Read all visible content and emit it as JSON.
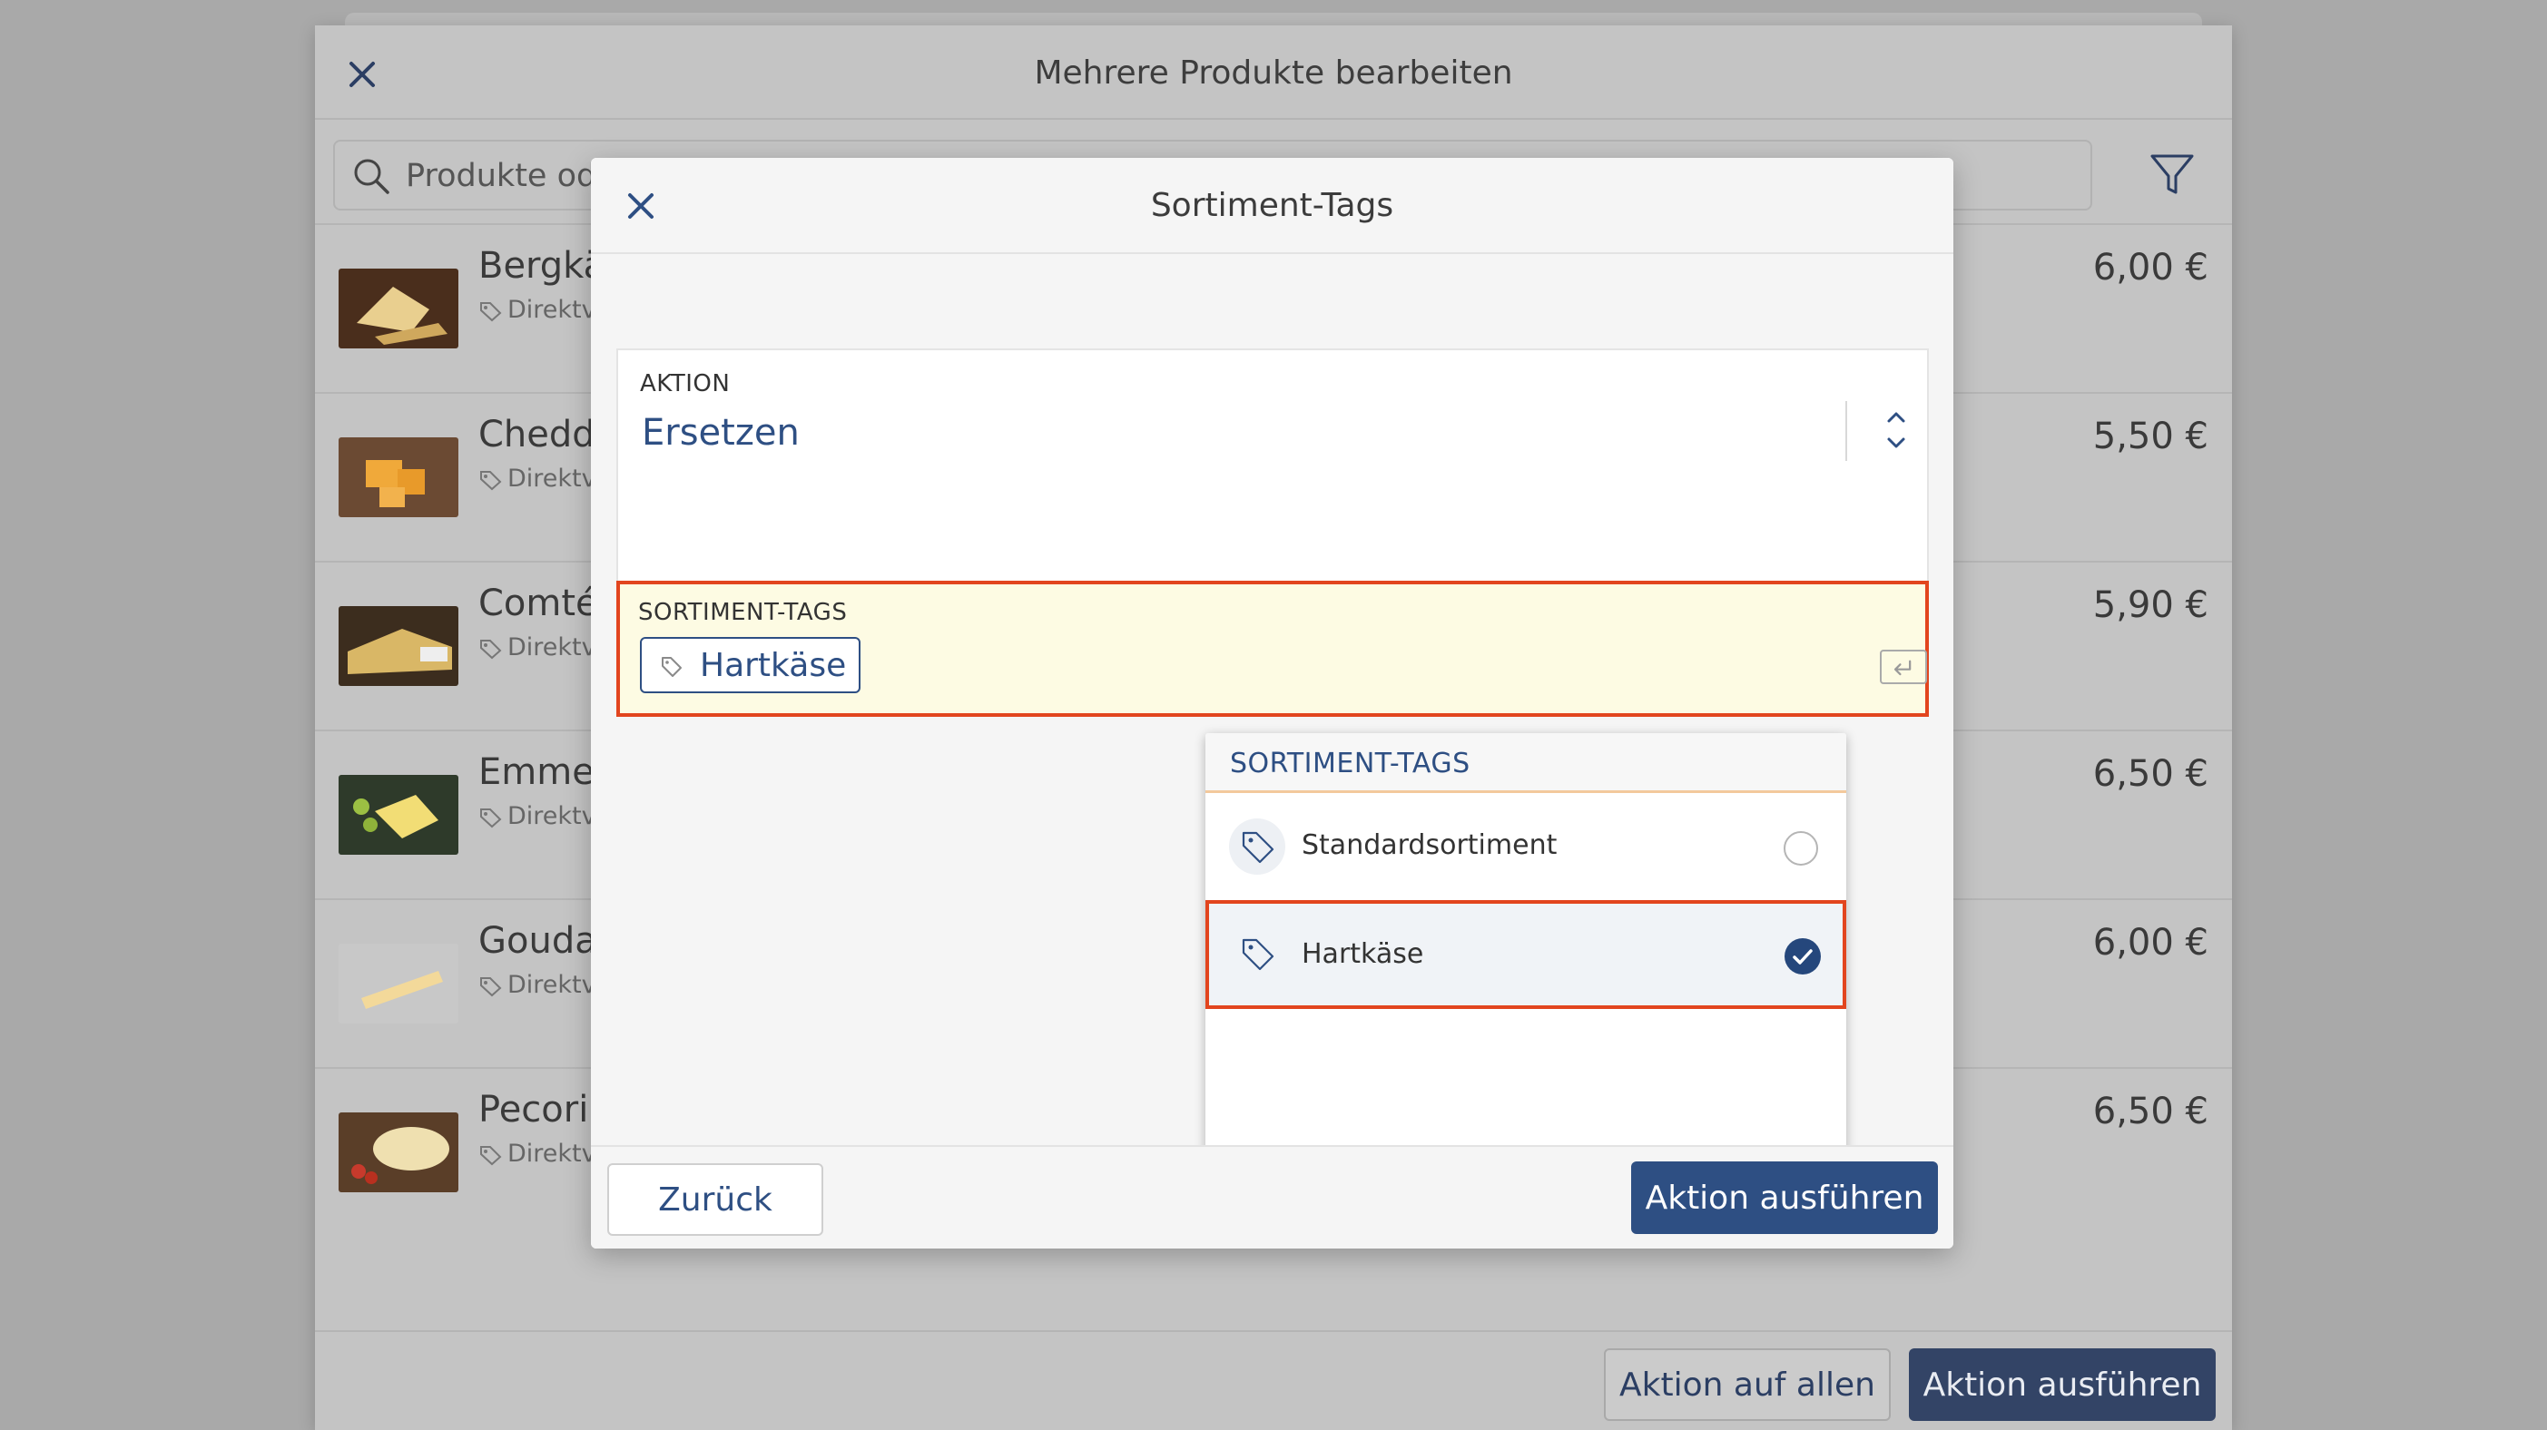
{
  "background": {
    "title": "Mehrere Produkte bearbeiten",
    "search_placeholder": "Produkte oder",
    "products": [
      {
        "name": "Bergkä",
        "sub": "Direktve",
        "price": "6,00 €"
      },
      {
        "name": "Chedda",
        "sub": "Direktve",
        "price": "5,50 €"
      },
      {
        "name": "Comté",
        "sub": "Direktve",
        "price": "5,90 €"
      },
      {
        "name": "Emmen",
        "sub": "Direktve",
        "price": "6,50 €"
      },
      {
        "name": "Gouda",
        "sub": "Direktve",
        "price": "6,00 €"
      },
      {
        "name": "Pecorir",
        "sub": "Direktve",
        "price": "6,50 €"
      }
    ],
    "footer": {
      "action_all_label": "Aktion auf allen",
      "run_label": "Aktion ausführen"
    }
  },
  "modal": {
    "title": "Sortiment-Tags",
    "aktion_label": "AKTION",
    "aktion_value": "Ersetzen",
    "tags_label": "SORTIMENT-TAGS",
    "selected_tag": "Hartkäse",
    "dropdown": {
      "header": "SORTIMENT-TAGS",
      "items": [
        {
          "label": "Standardsortiment",
          "selected": false
        },
        {
          "label": "Hartkäse",
          "selected": true
        }
      ]
    },
    "footer": {
      "back_label": "Zurück",
      "run_label": "Aktion ausführen"
    }
  },
  "colors": {
    "accent": "#2e4f83",
    "highlight_border": "#e2451e",
    "tag_field_bg": "#fdfbe3"
  },
  "icons": [
    "close-icon",
    "search-icon",
    "filter-icon",
    "tag-icon",
    "enter-key-icon",
    "chevron-updown-icon",
    "checkmark-icon"
  ]
}
